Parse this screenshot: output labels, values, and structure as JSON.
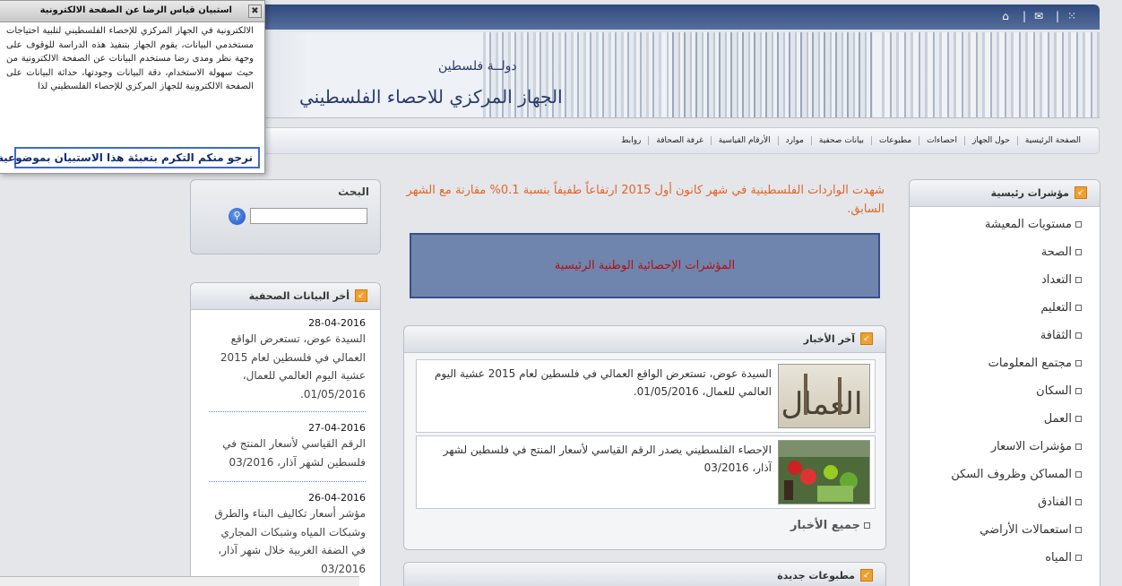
{
  "popup": {
    "title": "استبيان قياس الرضا عن الصفحة الالكترونية",
    "close": "✖",
    "body": "الالكترونية في الجهاز المركزي للإحصاء الفلسطيني لتلبية احتياجات مستخدمي البيانات، يقوم الجهاز بتنفيذ هذه الدراسة للوقوف على وجهة نظر ومدى رضا مستخدم البيانات عن الصفحة الالكترونية من حيث سهولة الاستخدام، دقة البيانات وجودتها، حداثة البيانات على الصفحة الالكترونية للجهاز المركزي للإحصاء الفلسطيني لذا",
    "link": "نرجو منكم التكرم بتعبئة هذا الاستبيان بموضوعية."
  },
  "banner": {
    "state": "دولــة فلسطين",
    "org": "الجهاز المركزي للاحصاء الفلسطيني"
  },
  "nav": {
    "items": [
      "الصفحة الرئيسية",
      "حول الجهاز",
      "احصاءات",
      "مطبوعات",
      "بيانات صحفية",
      "موارد",
      "الأرقام القياسية",
      "غرفة الصحافة",
      "روابط"
    ]
  },
  "search": {
    "title": "البحث",
    "placeholder": "",
    "button_icon": "search-icon"
  },
  "press": {
    "title": "أخر البيانات الصحفية",
    "items": [
      {
        "date": "28-04-2016",
        "text": "السيدة عوض، تستعرض الواقع العمالي في فلسطين لعام 2015 عشية اليوم العالمي للعمال، 01/05/2016."
      },
      {
        "date": "27-04-2016",
        "text": "الرقم القياسي لأسعار المنتج في فلسطين لشهر آذار، 03/2016"
      },
      {
        "date": "26-04-2016",
        "text": "مؤشر أسعار تكاليف البناء والطرق وشبكات المياه وشبكات المجاري في الضفة الغربية خلال شهر آذار، 03/2016"
      }
    ]
  },
  "headline": "شهدت الواردات الفلسطينية في شهر كانون أول 2015 ارتفاعاً طفيفاً بنسبة 0.1% مقارنة مع الشهر السابق.",
  "indicators_label": "المؤشرات الإحصائية الوطنية الرئيسية",
  "news": {
    "title": "آخر الأخبار",
    "items": [
      {
        "text": "السيدة عوض، تستعرض الواقع العمالي في فلسطين لعام 2015 عشية اليوم العالمي للعمال، 01/05/2016."
      },
      {
        "text": "الإحصاء الفلسطيني يصدر الرقم القياسي لأسعار المنتج في فلسطين لشهر آذار، 03/2016"
      }
    ],
    "all": "جميع الأخبار"
  },
  "pubs": {
    "title": "مطبوعات جديدة"
  },
  "main_indicators": {
    "title": "مؤشرات رئيسية",
    "items": [
      "مستويات المعيشة",
      "الصحة",
      "التعداد",
      "التعليم",
      "الثقافة",
      "مجتمع المعلومات",
      "السكان",
      "العمل",
      "مؤشرات الاسعار",
      "المساكن وظروف السكن",
      "الفنادق",
      "استعمالات الأراضي",
      "المياه"
    ]
  },
  "colors": {
    "accent_orange": "#e0652a",
    "header_blue": "#2f4a7e",
    "indicator_box": "#6f85ad"
  }
}
